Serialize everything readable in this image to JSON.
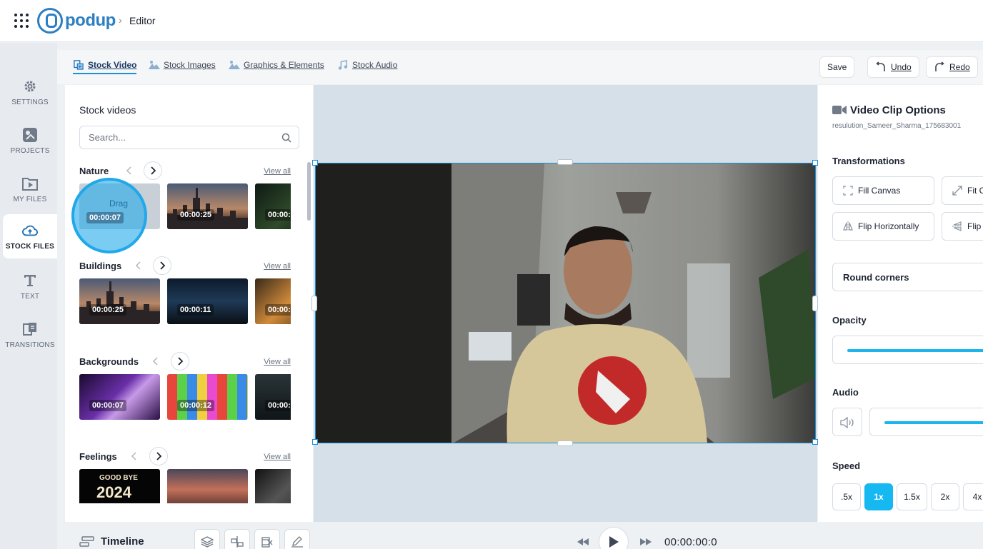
{
  "header": {
    "brand": "podup",
    "breadcrumb_sep": "›",
    "breadcrumb": "Editor"
  },
  "nav": [
    {
      "label": "SETTINGS",
      "icon": "gear-icon"
    },
    {
      "label": "PROJECTS",
      "icon": "projects-icon"
    },
    {
      "label": "MY FILES",
      "icon": "folder-play-icon"
    },
    {
      "label": "STOCK FILES",
      "icon": "cloud-icon",
      "active": true
    },
    {
      "label": "TEXT",
      "icon": "text-icon"
    },
    {
      "label": "TRANSITIONS",
      "icon": "transitions-icon"
    }
  ],
  "tabs": [
    {
      "label": "Stock Video",
      "icon": "stock-video-icon",
      "active": true
    },
    {
      "label": "Stock Images",
      "icon": "image-icon"
    },
    {
      "label": "Graphics & Elements",
      "icon": "graphics-icon"
    },
    {
      "label": "Stock Audio",
      "icon": "music-icon"
    }
  ],
  "actions": {
    "save": "Save",
    "undo": "Undo",
    "redo": "Redo"
  },
  "stock": {
    "title": "Stock videos",
    "search_placeholder": "Search...",
    "view_all": "View all",
    "drag_label": "Drag",
    "sections": [
      {
        "name": "Nature",
        "durations": [
          "00:00:07",
          "00:00:25",
          "00:00:"
        ]
      },
      {
        "name": "Buildings",
        "durations": [
          "00:00:25",
          "00:00:11",
          "00:00:"
        ]
      },
      {
        "name": "Backgrounds",
        "durations": [
          "00:00:07",
          "00:00:12",
          "00:00:"
        ]
      },
      {
        "name": "Feelings",
        "durations": [
          "",
          "",
          ""
        ],
        "banner": [
          "GOOD BYE",
          "2024"
        ]
      }
    ]
  },
  "options": {
    "title": "Video Clip Options",
    "filename": "resulution_Sameer_Sharma_175683001",
    "transformations_label": "Transformations",
    "buttons": [
      "Fill Canvas",
      "Fit C",
      "Flip Horizontally",
      "Flip"
    ],
    "round_corners": "Round corners",
    "opacity_label": "Opacity",
    "opacity_value": 1.0,
    "audio_label": "Audio",
    "audio_value": 1.0,
    "speed_label": "Speed",
    "speeds": [
      ".5x",
      "1x",
      "1.5x",
      "2x",
      "4x"
    ],
    "active_speed": "1x"
  },
  "timeline": {
    "title": "Timeline",
    "time": "00:00:00:0"
  },
  "colors": {
    "accent": "#15b8f1",
    "brand": "#2d7fc1"
  }
}
